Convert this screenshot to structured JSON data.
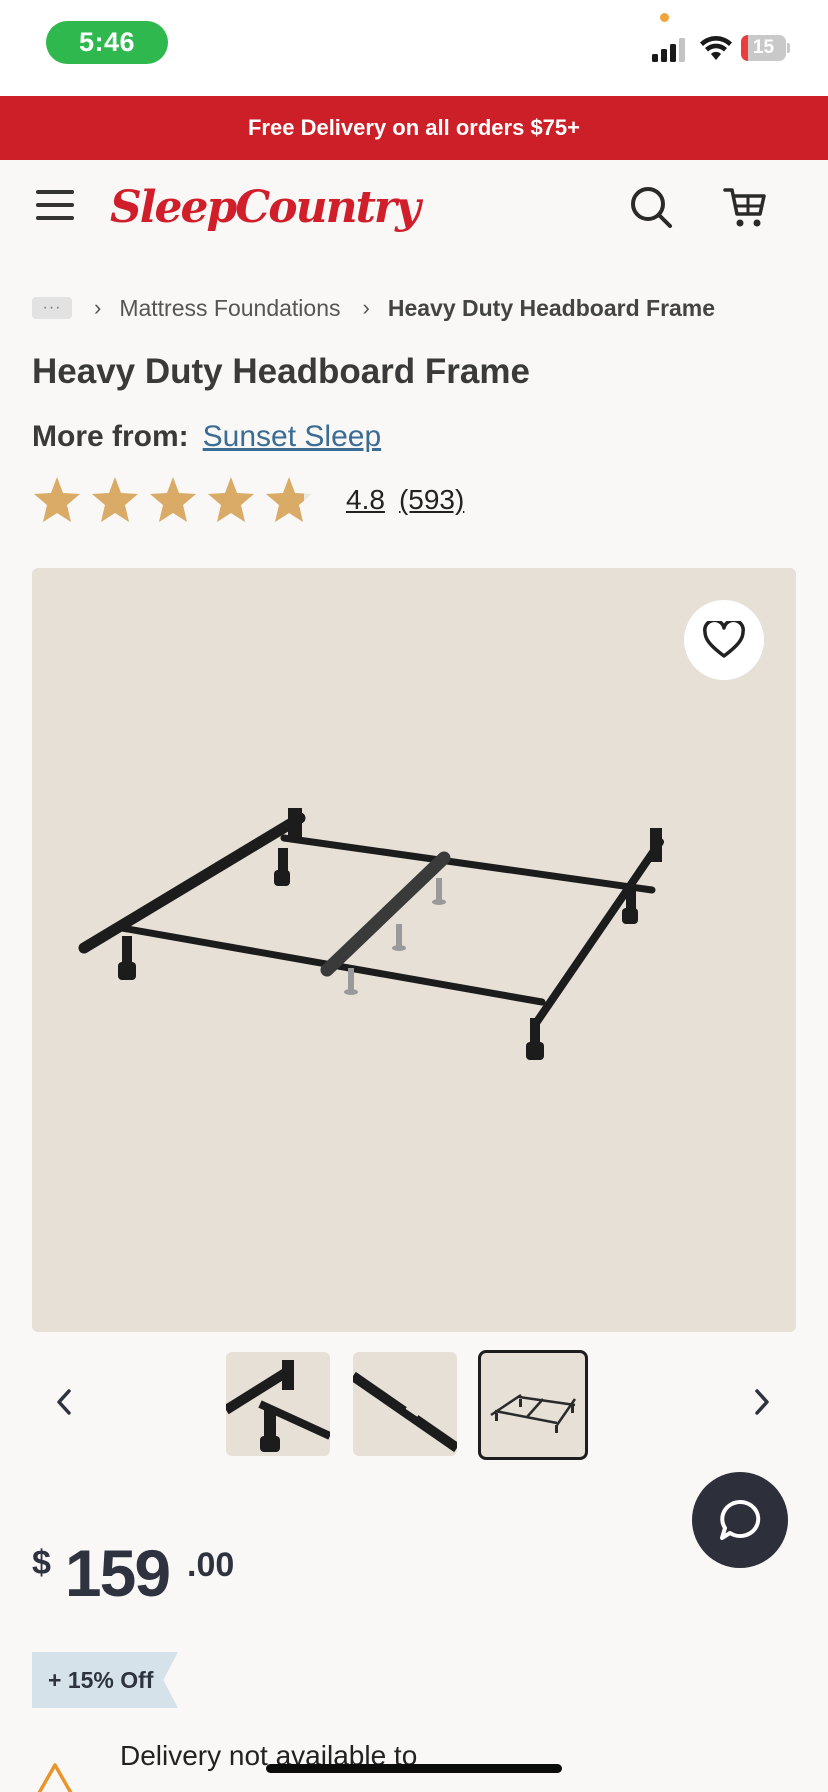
{
  "status_bar": {
    "time": "5:46",
    "battery_level": "15",
    "battery_fraction": 0.15,
    "icons": [
      "signal-icon",
      "wifi-icon",
      "battery-icon"
    ]
  },
  "promo": {
    "text": "Free Delivery on all orders $75+"
  },
  "header": {
    "logo_text": "SleepCountry",
    "brand_color": "#d01f2a",
    "icons": [
      "menu-icon",
      "search-icon",
      "cart-icon"
    ]
  },
  "breadcrumb": {
    "more_label": "···",
    "items": [
      "Mattress Foundations",
      "Heavy Duty Headboard Frame"
    ]
  },
  "product": {
    "title": "Heavy Duty Headboard Frame",
    "more_from_label": "More from:",
    "brand": "Sunset Sleep",
    "rating": "4.8",
    "rating_value": 4.8,
    "review_count": "(593)",
    "star_color": "#d9ab67"
  },
  "gallery": {
    "thumbnail_count": 3,
    "selected_index": 2
  },
  "price": {
    "currency": "$",
    "whole": "159",
    "cents": ".00",
    "discount": "+ 15% Off"
  },
  "delivery": {
    "text": "Delivery not available to"
  }
}
